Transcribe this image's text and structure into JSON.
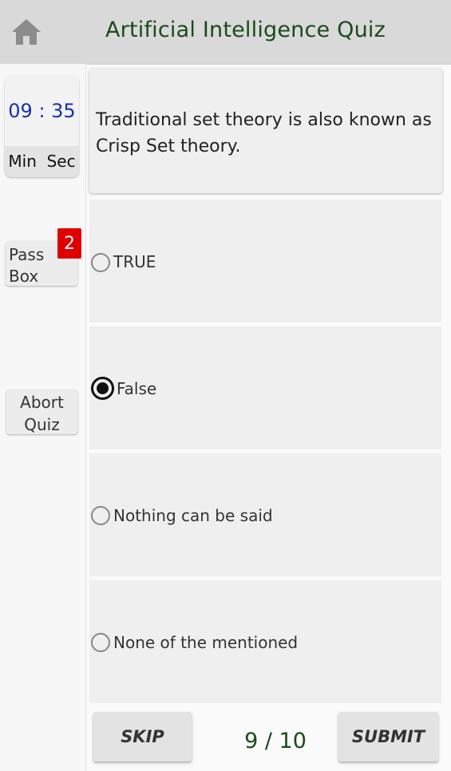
{
  "header": {
    "home_icon": "home-icon",
    "title": "Artificial Intelligence Quiz"
  },
  "timer": {
    "value": "09 : 35",
    "units": "Min  Sec"
  },
  "pass_box": {
    "label": "Pass Box",
    "count": "2"
  },
  "abort": {
    "label": "Abort Quiz"
  },
  "question": {
    "text": "Traditional set theory is also known as Crisp Set theory."
  },
  "options": [
    {
      "label": "TRUE",
      "selected": false
    },
    {
      "label": "False",
      "selected": true
    },
    {
      "label": "Nothing can be said",
      "selected": false
    },
    {
      "label": "None of the mentioned",
      "selected": false
    }
  ],
  "footer": {
    "skip_label": "SKIP",
    "submit_label": "SUBMIT",
    "progress": "9 / 10"
  },
  "colors": {
    "title": "#1b4a1b",
    "timer": "#1a2fb0",
    "badge": "#e00000",
    "header_bg": "#d9d9d9"
  }
}
